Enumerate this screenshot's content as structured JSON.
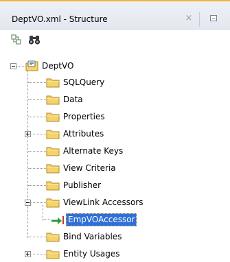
{
  "window": {
    "title": "DeptVO.xml - Structure",
    "close_glyph": "×"
  },
  "toolbar": {
    "buttons": [
      {
        "icon": "sync-with-editor-icon"
      },
      {
        "icon": "binoculars-find-icon"
      }
    ]
  },
  "tree": {
    "root": {
      "label": "DeptVO",
      "expanded": true
    },
    "items": [
      {
        "label": "SQLQuery",
        "expandable": false
      },
      {
        "label": "Data",
        "expandable": false
      },
      {
        "label": "Properties",
        "expandable": false
      },
      {
        "label": "Attributes",
        "expandable": true,
        "expanded": false
      },
      {
        "label": "Alternate Keys",
        "expandable": false
      },
      {
        "label": "View Criteria",
        "expandable": false
      },
      {
        "label": "Publisher",
        "expandable": false
      },
      {
        "label": "ViewLink Accessors",
        "expandable": true,
        "expanded": true
      },
      {
        "label": "Bind Variables",
        "expandable": false
      },
      {
        "label": "Entity Usages",
        "expandable": true,
        "expanded": false
      }
    ],
    "child": {
      "label": "EmpVOAccessor",
      "selected": true
    }
  },
  "colors": {
    "accent_border": "#f2b33d",
    "selection": "#2f6fd6",
    "folder": "#f4d36b"
  }
}
